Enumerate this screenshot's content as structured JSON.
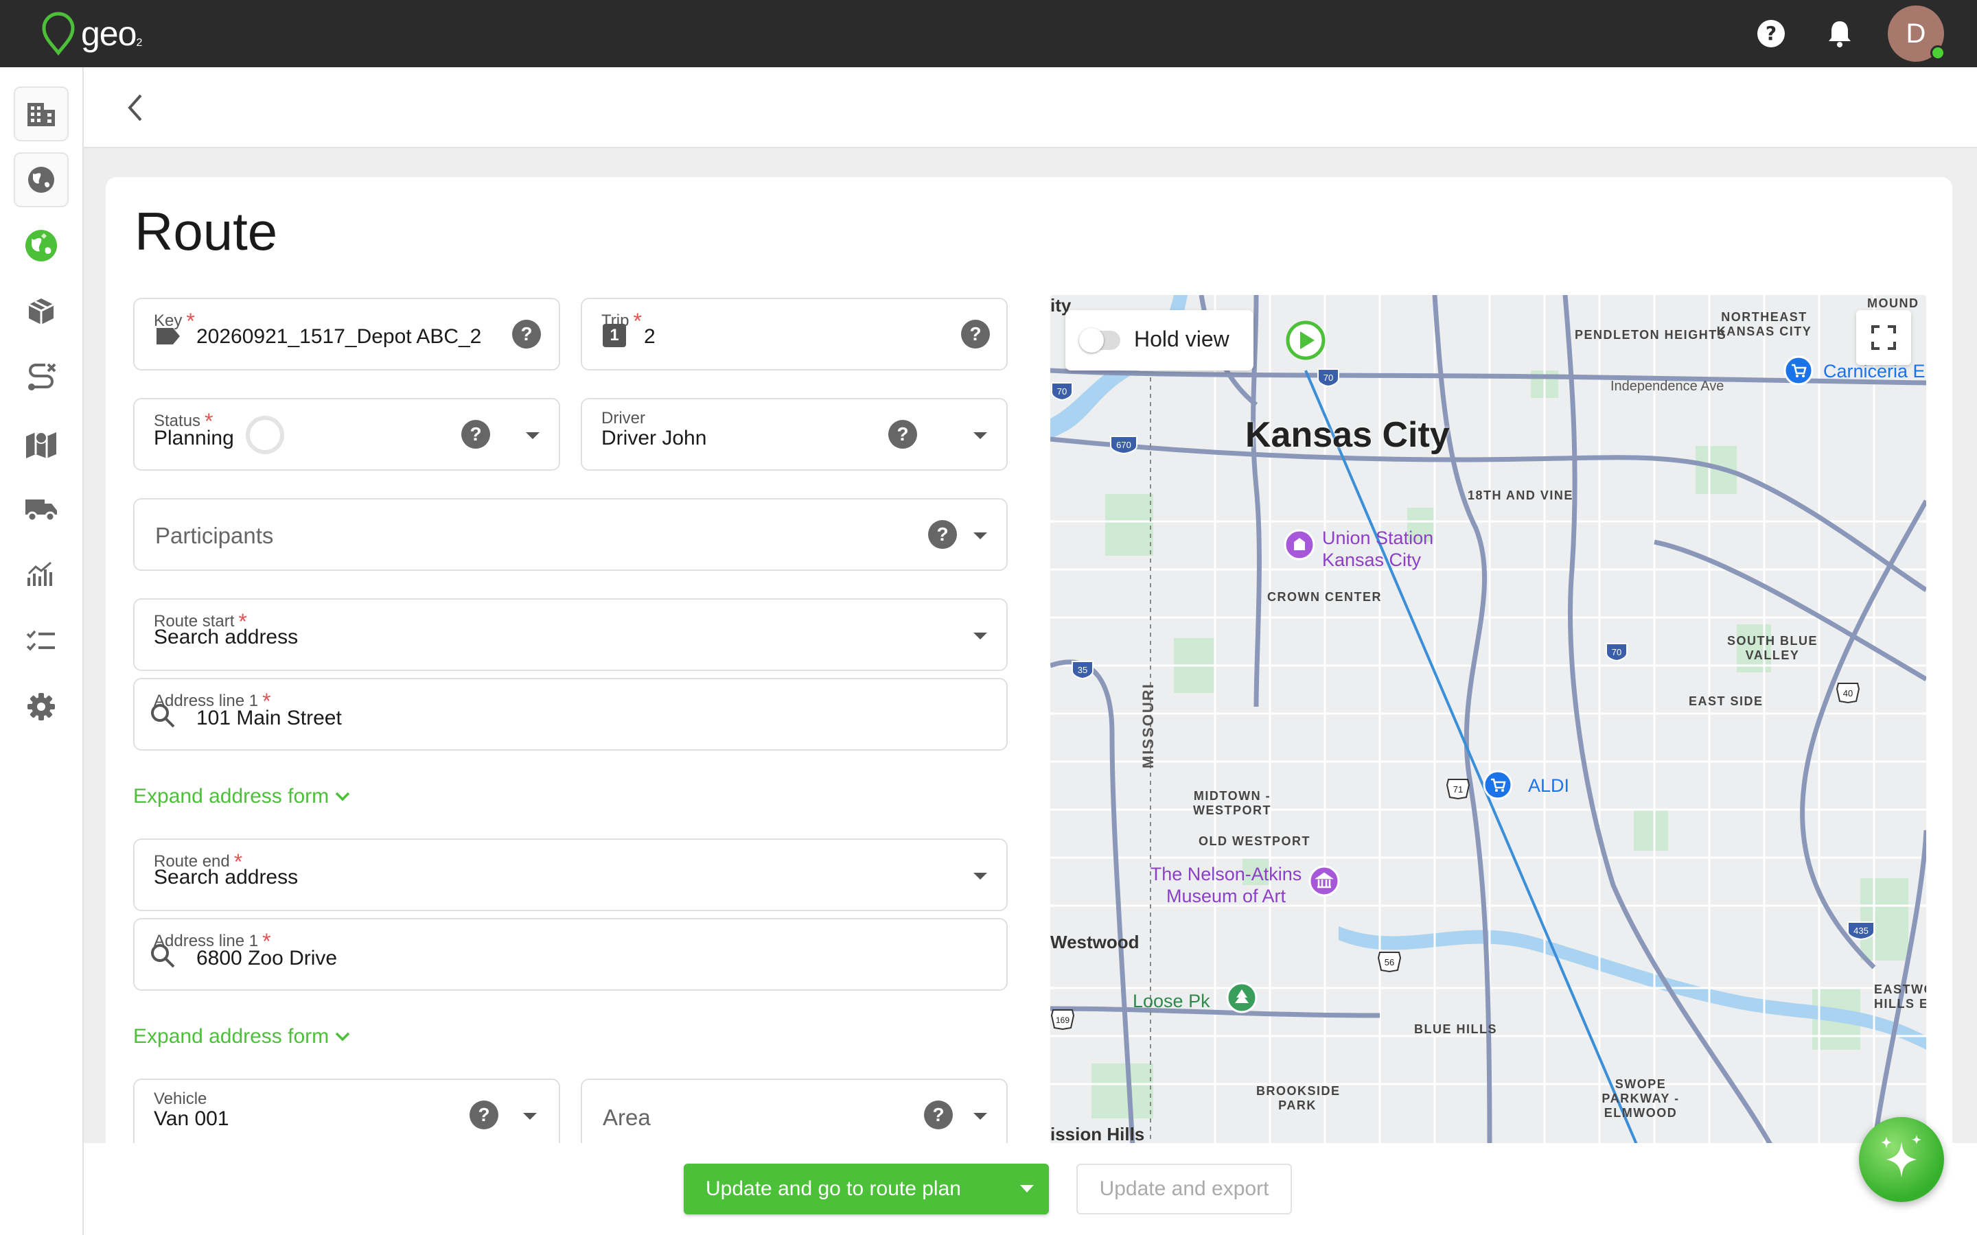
{
  "app": {
    "logo_text": "geo",
    "logo_sub": "2",
    "avatar_initial": "D",
    "brand_color": "#4cc038"
  },
  "sidebar": {
    "items": [
      {
        "name": "buildings",
        "icon": "building-icon"
      },
      {
        "name": "globe",
        "icon": "globe-icon"
      },
      {
        "name": "geo",
        "icon": "geo-globe-icon"
      },
      {
        "name": "packages",
        "icon": "package-icon"
      },
      {
        "name": "routes",
        "icon": "route-icon"
      },
      {
        "name": "maps",
        "icon": "map-icon"
      },
      {
        "name": "vehicles",
        "icon": "truck-icon"
      },
      {
        "name": "analytics",
        "icon": "chart-icon"
      },
      {
        "name": "tasks",
        "icon": "checklist-icon"
      },
      {
        "name": "settings",
        "icon": "gear-icon"
      }
    ]
  },
  "page": {
    "title": "Route"
  },
  "form": {
    "key": {
      "label": "Key",
      "value": "20260921_1517_Depot ABC_2"
    },
    "trip": {
      "label": "Trip",
      "badge": "1",
      "value": "2"
    },
    "status": {
      "label": "Status",
      "value": "Planning"
    },
    "driver": {
      "label": "Driver",
      "value": "Driver John"
    },
    "participants": {
      "placeholder": "Participants"
    },
    "route_start": {
      "label": "Route start",
      "value": "Search address"
    },
    "start_address": {
      "label": "Address line 1",
      "value": "101 Main Street"
    },
    "expand_1": "Expand address form",
    "route_end": {
      "label": "Route end",
      "value": "Search address"
    },
    "end_address": {
      "label": "Address line 1",
      "value": "6800 Zoo Drive"
    },
    "expand_2": "Expand address form",
    "vehicle": {
      "label": "Vehicle",
      "value": "Van 001"
    },
    "area": {
      "placeholder": "Area"
    }
  },
  "map": {
    "hold_view_label": "Hold view",
    "hold_view_on": false,
    "city": "Kansas City",
    "labels": {
      "city_edge": "ity",
      "northeast": "NORTHEAST KANSAS CITY",
      "pendleton": "PENDLETON HEIGHTS",
      "mound": "MOUND",
      "independence_ave": "Independence Ave",
      "carniceria": "Carniceria E",
      "eighteenth_vine": "18TH AND VINE",
      "union_station": "Union Station Kansas City",
      "crown_center": "CROWN CENTER",
      "south_blue_valley": "SOUTH BLUE VALLEY",
      "east_side": "EAST SIDE",
      "missouri": "MISSOURI",
      "midtown": "MIDTOWN - WESTPORT",
      "old_westport": "OLD WESTPORT",
      "aldi": "ALDI",
      "nelson_atkins": "The Nelson-Atkins Museum of Art",
      "westwood": "Westwood",
      "loose_pk": "Loose Pk",
      "blue_hills": "BLUE HILLS",
      "brookside": "BROOKSIDE PARK",
      "swope": "SWOPE PARKWAY - ELMWOOD",
      "eastwood": "EASTWO HILLS E",
      "mission_hills": "ission Hills"
    },
    "shields": [
      "70",
      "70",
      "670",
      "35",
      "71",
      "70",
      "40",
      "56",
      "169",
      "435"
    ]
  },
  "actions": {
    "primary": "Update and go to route plan",
    "secondary": "Update and export"
  }
}
